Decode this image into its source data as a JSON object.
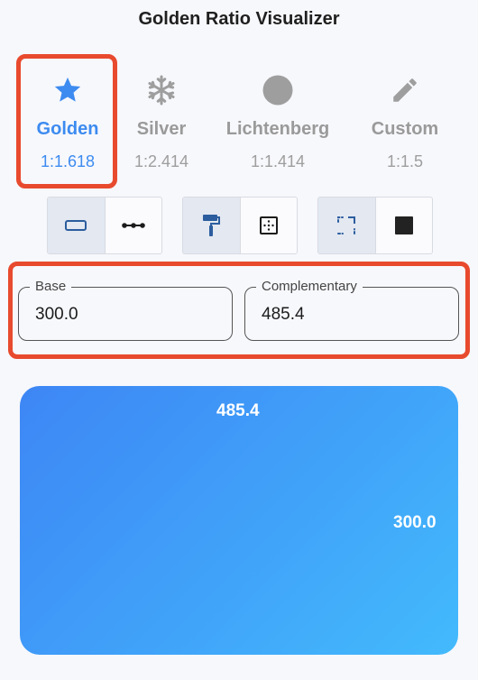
{
  "app": {
    "title": "Golden Ratio Visualizer"
  },
  "ratios": [
    {
      "name": "Golden",
      "value": "1:1.618",
      "icon": "star-icon",
      "selected": true
    },
    {
      "name": "Silver",
      "value": "1:2.414",
      "icon": "snowflake-icon",
      "selected": false
    },
    {
      "name": "Lichtenberg",
      "value": "1:1.414",
      "icon": "circle-icon",
      "selected": false
    },
    {
      "name": "Custom",
      "value": "1:1.5",
      "icon": "pencil-icon",
      "selected": false
    }
  ],
  "toggles": {
    "shape": {
      "options": [
        "rectangle-icon",
        "line-icon"
      ],
      "selected": 0
    },
    "style": {
      "options": [
        "paint-roller-icon",
        "dotted-square-icon"
      ],
      "selected": 0
    },
    "fill": {
      "options": [
        "dashed-corner-square-icon",
        "filled-square-icon"
      ],
      "selected": 0
    }
  },
  "fields": {
    "base": {
      "label": "Base",
      "value": "300.0"
    },
    "complementary": {
      "label": "Complementary",
      "value": "485.4"
    }
  },
  "preview": {
    "width_label": "485.4",
    "height_label": "300.0"
  },
  "colors": {
    "accent": "#3d8bf0",
    "highlight": "#e84a2e",
    "gradient_start": "#3d86f5",
    "gradient_end": "#43bafc"
  }
}
